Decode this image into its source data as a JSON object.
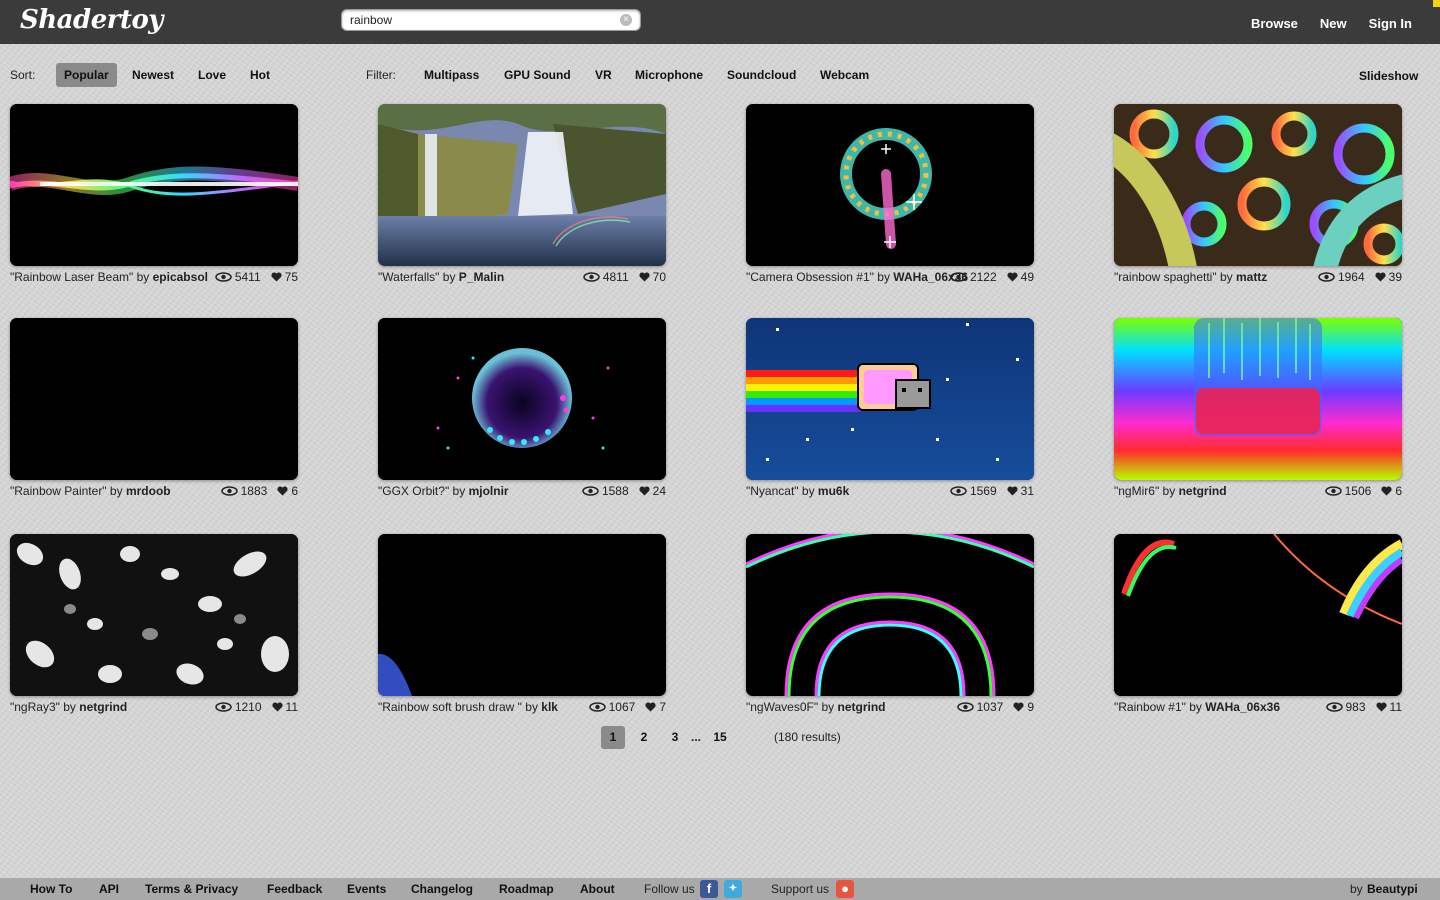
{
  "header": {
    "logo": "Shadertoy",
    "search_value": "rainbow",
    "nav": [
      "Browse",
      "New",
      "Sign In"
    ]
  },
  "sortbar": {
    "sort_label": "Sort:",
    "sort_options": [
      "Popular",
      "Newest",
      "Love",
      "Hot"
    ],
    "active_sort": "Popular",
    "filter_label": "Filter:",
    "filters": [
      "Multipass",
      "GPU Sound",
      "VR",
      "Microphone",
      "Soundcloud",
      "Webcam"
    ],
    "slideshow": "Slideshow"
  },
  "shaders": [
    {
      "title": "\"Rainbow Laser Beam\"",
      "author": "epicabsol",
      "views": "5411",
      "likes": "75"
    },
    {
      "title": "\"Waterfalls\"",
      "author": "P_Malin",
      "views": "4811",
      "likes": "70"
    },
    {
      "title": "\"Camera Obsession #1\"",
      "author": "WAHa_06x36",
      "views": "2122",
      "likes": "49"
    },
    {
      "title": "\"rainbow spaghetti\"",
      "author": "mattz",
      "views": "1964",
      "likes": "39"
    },
    {
      "title": "\"Rainbow Painter\"",
      "author": "mrdoob",
      "views": "1883",
      "likes": "6"
    },
    {
      "title": "\"GGX Orbit?\"",
      "author": "mjolnir",
      "views": "1588",
      "likes": "24"
    },
    {
      "title": "\"Nyancat\"",
      "author": "mu6k",
      "views": "1569",
      "likes": "31"
    },
    {
      "title": "\"ngMir6\"",
      "author": "netgrind",
      "views": "1506",
      "likes": "6"
    },
    {
      "title": "\"ngRay3\"",
      "author": "netgrind",
      "views": "1210",
      "likes": "11"
    },
    {
      "title": "\"Rainbow soft brush draw \"",
      "author": "klk",
      "views": "1067",
      "likes": "7"
    },
    {
      "title": "\"ngWaves0F\"",
      "author": "netgrind",
      "views": "1037",
      "likes": "9"
    },
    {
      "title": "\"Rainbow #1\"",
      "author": "WAHa_06x36",
      "views": "983",
      "likes": "11"
    }
  ],
  "by_label": "by",
  "pagination": {
    "pages": [
      "1",
      "2",
      "3",
      "15"
    ],
    "current": "1",
    "ellipsis": "...",
    "results": "(180 results)"
  },
  "footer": {
    "links": [
      "How To",
      "API",
      "Terms & Privacy",
      "Feedback",
      "Events",
      "Changelog",
      "Roadmap",
      "About"
    ],
    "follow_label": "Follow us",
    "support_label": "Support us",
    "credit_prefix": "by",
    "credit_name": "Beautypi"
  },
  "icons": {
    "search_clear": "clear-icon",
    "views": "eye-icon",
    "likes": "heart-icon",
    "facebook": "facebook-icon",
    "twitter": "twitter-icon",
    "patreon": "patreon-icon"
  }
}
